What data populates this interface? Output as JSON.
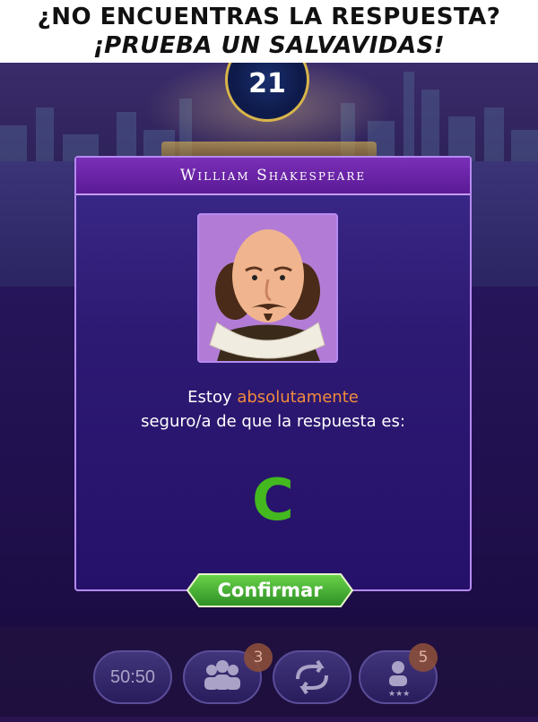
{
  "banner": {
    "line1": "¿NO ENCUENTRAS LA RESPUESTA?",
    "line2": "¡PRUEBA UN SALVAVIDAS!"
  },
  "game": {
    "question_number": "21"
  },
  "dialog": {
    "title": "William Shakespeare",
    "message_part1": "Estoy ",
    "message_highlight": "absolutamente",
    "message_part2": "seguro/a de que la respuesta es:",
    "answer": "C",
    "confirm_label": "Confirmar"
  },
  "lifelines": {
    "fifty_fifty": "50:50",
    "audience_count": "3",
    "friend_count": "5"
  },
  "colors": {
    "highlight": "#f28b3c",
    "answer": "#43b81f",
    "confirm_button": "#3aa43a"
  }
}
